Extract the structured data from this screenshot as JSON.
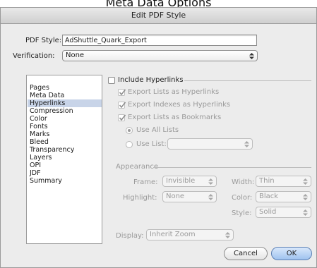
{
  "caption": "Meta Data Options",
  "window": {
    "title": "Edit PDF Style"
  },
  "form": {
    "pdf_style_label": "PDF Style:",
    "pdf_style_value": "AdShuttle_Quark_Export",
    "verification_label": "Verification:",
    "verification_value": "None"
  },
  "sidebar": {
    "items": [
      {
        "label": "Pages",
        "selected": false
      },
      {
        "label": "Meta Data",
        "selected": false
      },
      {
        "label": "Hyperlinks",
        "selected": true
      },
      {
        "label": "Compression",
        "selected": false
      },
      {
        "label": "Color",
        "selected": false
      },
      {
        "label": "Fonts",
        "selected": false
      },
      {
        "label": "Marks",
        "selected": false
      },
      {
        "label": "Bleed",
        "selected": false
      },
      {
        "label": "Transparency",
        "selected": false
      },
      {
        "label": "Layers",
        "selected": false
      },
      {
        "label": "OPI",
        "selected": false
      },
      {
        "label": "JDF",
        "selected": false
      },
      {
        "label": "Summary",
        "selected": false
      }
    ]
  },
  "hyperlinks": {
    "include_label": "Include Hyperlinks",
    "include_checked": false,
    "export_lists_label": "Export Lists as Hyperlinks",
    "export_lists_checked": true,
    "export_indexes_label": "Export Indexes as Hyperlinks",
    "export_indexes_checked": true,
    "export_bookmarks_label": "Export Lists as Bookmarks",
    "export_bookmarks_checked": true,
    "use_all_lists_label": "Use All Lists",
    "use_all_lists_selected": true,
    "use_list_label": "Use List:",
    "use_list_value": ""
  },
  "appearance": {
    "heading": "Appearance",
    "frame_label": "Frame:",
    "frame_value": "Invisible",
    "width_label": "Width:",
    "width_value": "Thin",
    "highlight_label": "Highlight:",
    "highlight_value": "None",
    "color_label": "Color:",
    "color_value": "Black",
    "style_label": "Style:",
    "style_value": "Solid"
  },
  "display": {
    "label": "Display:",
    "value": "Inherit Zoom"
  },
  "buttons": {
    "cancel": "Cancel",
    "ok": "OK"
  },
  "colors": {
    "selection": "#c8d4e8",
    "disabled_text": "#9a9a9a",
    "default_button": "#9fc3ef"
  },
  "icons": {
    "popup_arrows": "updown-arrows-icon",
    "checkmark": "checkmark-icon"
  }
}
